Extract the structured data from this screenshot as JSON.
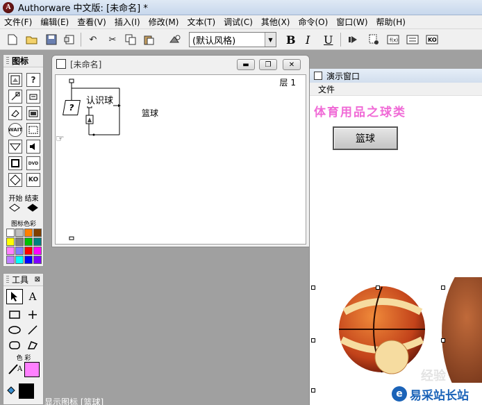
{
  "app": {
    "title": "Authorware 中文版: [未命名] *",
    "icon": "A"
  },
  "menu": [
    "文件(F)",
    "编辑(E)",
    "查看(V)",
    "插入(I)",
    "修改(M)",
    "文本(T)",
    "调试(C)",
    "其他(X)",
    "命令(O)",
    "窗口(W)",
    "帮助(H)"
  ],
  "toolbar": {
    "style_value": "(默认风格)",
    "bold": "B",
    "italic": "I",
    "underline": "U",
    "icons": [
      "new-icon",
      "open-icon",
      "save-all-icon",
      "import-icon",
      "undo-icon",
      "cut-icon",
      "copy-icon",
      "paste-icon",
      "find-icon"
    ]
  },
  "icon_palette": {
    "title": "图标",
    "start_label": "开始",
    "end_label": "结束",
    "color_label": "图标色彩",
    "wait_label": "WAIT",
    "dvd_label": "DVD",
    "ko_label": "KO",
    "swatch_colors": [
      "#ffffff",
      "#c0c0c0",
      "#ff8000",
      "#804000",
      "#ffff00",
      "#808080",
      "#00c000",
      "#008080",
      "#ff80ff",
      "#8080ff",
      "#ff0000",
      "#ff00ff",
      "#c080ff",
      "#00ffff",
      "#0000ff",
      "#8000ff"
    ]
  },
  "tools_palette": {
    "title": "工具",
    "close": "⊠",
    "text_tool": "A",
    "color_label": "色 彩",
    "fill_label": "A",
    "colors": {
      "line": "#000000",
      "fill": "#ff80ff"
    }
  },
  "flow_window": {
    "title": "[未命名]",
    "layer": "层 1",
    "interaction_label": "认识球",
    "response_label": "篮球",
    "interaction_glyph": "?"
  },
  "presentation": {
    "title": "演示窗口",
    "menu_file": "文件",
    "heading": "体育用品之球类",
    "button_label": "篮球"
  },
  "status_text": "显示图标 [篮球]",
  "watermark": {
    "logo": "e",
    "text": "易采站长站",
    "faint": "经验"
  }
}
